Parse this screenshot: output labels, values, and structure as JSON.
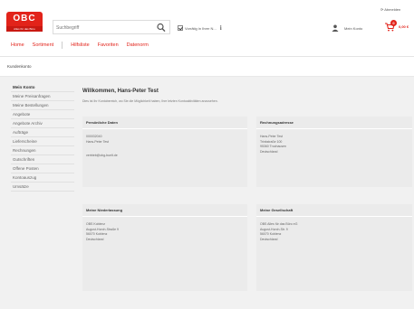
{
  "header": {
    "logo": {
      "top": "OBC",
      "bottom": "Alles für das Büro"
    },
    "search": {
      "placeholder": "Suchbegriff"
    },
    "vorrat_label": "Vorrätig in Ihrer N...",
    "logout_label": "⟳ Abmelden",
    "account_label": "Mein Konto",
    "cart": {
      "count": "0",
      "amount": "0,00 €"
    },
    "nav": [
      "Home",
      "Sortiment",
      "Hilfsliste",
      "Favoriten",
      "Datenorm"
    ]
  },
  "breadcrumb": "Kundenkonto",
  "sidebar": {
    "items": [
      "Mein Konto",
      "Meine Preisanfragen",
      "Meine Bestellungen",
      "Angebote",
      "Angebote Archiv",
      "Aufträge",
      "Lieferscheine",
      "Rechnungen",
      "Gutschriften",
      "Offene Posten",
      "Kontoauszug",
      "Umsätze"
    ],
    "active_index": 0
  },
  "main": {
    "title": "Willkommen, Hans-Peter Test",
    "intro": "Dies ist Ihr Kontobereich, wo Sie die Möglichkeit haben, Ihre letzten Kontoaktivitäten anzusehen.",
    "cards": {
      "personal": {
        "heading": "Persönliche Daten",
        "line1": "000032040",
        "line2": "Hans-Peter Test",
        "line3": "vertrieb@obg-buelt.de"
      },
      "billing": {
        "heading": "Rechnungsadresse",
        "line1": "Hans-Peter Test",
        "line2": "Trinkstraße 100",
        "line3": "95360 Trochausen",
        "line4": "Deutschland"
      },
      "store": {
        "heading": "Meine Niederlassung",
        "line1": "OBS Koblenz",
        "line2": "August-Horch-Straße 9",
        "line3": "56070 Koblenz",
        "line4": "Deutschland"
      },
      "company": {
        "heading": "Meine Gesellschaft",
        "line1": "OBS Alles für das Büro eG",
        "line2": "August-Horch-Str. 9",
        "line3": "56070 Koblenz",
        "line4": "Deutschland"
      }
    }
  },
  "colors": {
    "accent": "#e2231a",
    "card": "#ebebeb",
    "page": "#f1f1f1"
  }
}
